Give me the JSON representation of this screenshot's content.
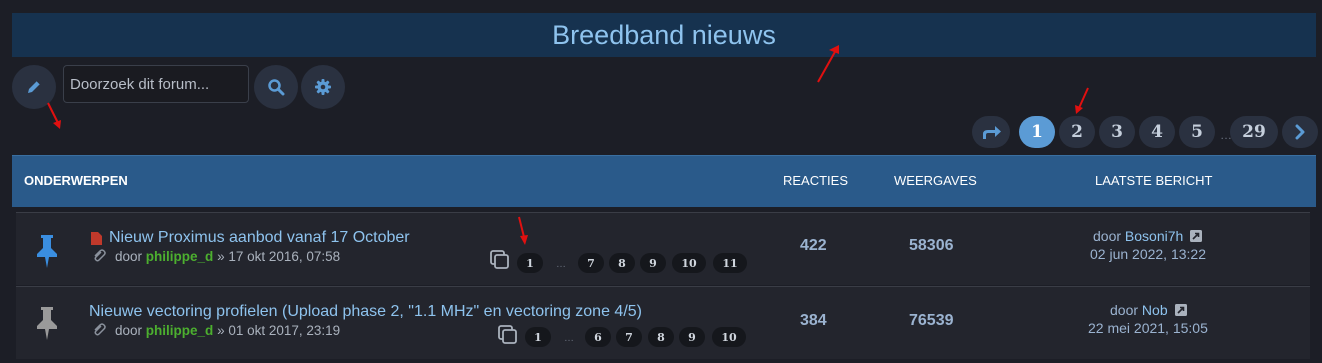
{
  "forum": {
    "title": "Breedband nieuws"
  },
  "toolbar": {
    "new_topic_icon": "pencil-icon",
    "search_placeholder": "Doorzoek dit forum...",
    "search_icon": "search-icon",
    "settings_icon": "gear-icon"
  },
  "pagination": {
    "jump_icon": "share-arrow-icon",
    "pages": [
      "1",
      "2",
      "3",
      "4",
      "5"
    ],
    "last_page": "29",
    "next_icon": "chevron-right-icon"
  },
  "table_header": {
    "topics": "ONDERWERPEN",
    "replies": "REACTIES",
    "views": "WEERGAVES",
    "last_post": "LAATSTE BERICHT"
  },
  "topics": [
    {
      "title": "Nieuw Proximus aanbod vanaf 17 October",
      "by": "door",
      "author": "philippe_d",
      "date": "» 17 okt 2016, 07:58",
      "pages_first": [
        "1"
      ],
      "pages_last": [
        "7",
        "8",
        "9",
        "10",
        "11"
      ],
      "replies": "422",
      "views": "58306",
      "last_by": "door",
      "last_user": "Bosoni7h",
      "last_date": "02 jun 2022, 13:22",
      "pin_color": "#3a8ee0"
    },
    {
      "title": "Nieuwe vectoring profielen (Upload phase 2, \"1.1 MHz\" en vectoring zone 4/5)",
      "by": "door",
      "author": "philippe_d",
      "date": "» 01 okt 2017, 23:19",
      "pages_first": [
        "1"
      ],
      "pages_last": [
        "6",
        "7",
        "8",
        "9",
        "10"
      ],
      "replies": "384",
      "views": "76539",
      "last_by": "door",
      "last_user": "Nob",
      "last_date": "22 mei 2021, 15:05",
      "pin_color": "#9a9a9a"
    }
  ],
  "colors": {
    "title_bar": "#16324f",
    "header_row": "#2a5a8a",
    "link": "#8ec3ee",
    "author": "#4caf2f",
    "annotation_arrow": "#e01010"
  }
}
